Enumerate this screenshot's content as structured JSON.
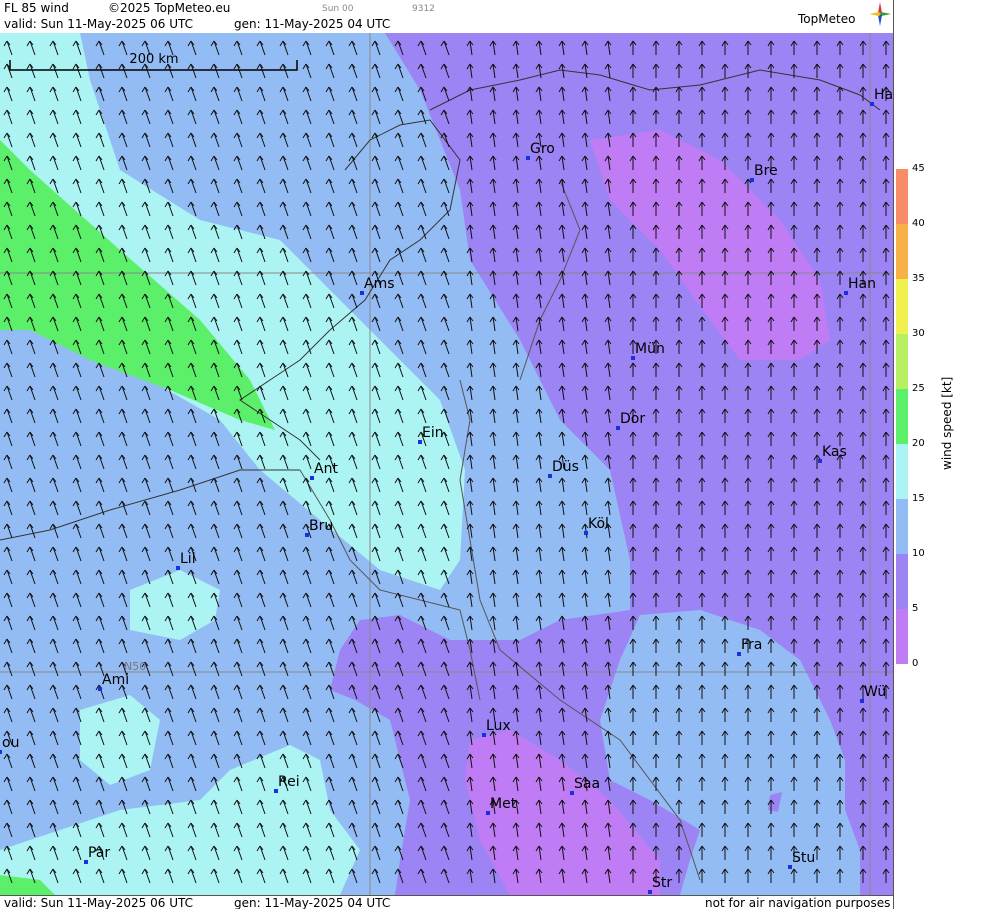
{
  "header": {
    "product": "FL 85 wind",
    "copyright": "©2025 TopMeteo.eu",
    "day_code": "Sun 00",
    "code": "9312",
    "valid": "valid:  Sun  11-May-2025  06 UTC",
    "gen": "gen: 11-May-2025 04 UTC",
    "logo": "TopMeteo"
  },
  "footer": {
    "valid": "valid:  Sun  11-May-2025  06 UTC",
    "gen": "gen: 11-May-2025 04 UTC",
    "disclaimer": "not for air navigation purposes"
  },
  "scale_bar": "200 km",
  "graticule_label": "N50",
  "colors": {
    "c0": "#c07cf4",
    "c5": "#9c84f4",
    "c10": "#94bcf4",
    "c15": "#acf4f4",
    "c20": "#5cf06a",
    "c25": "#b8f064",
    "c30": "#f0f050",
    "c35": "#f8b048",
    "c40": "#f88c68"
  },
  "legend": {
    "label": "wind speed [kt]",
    "ticks": [
      "45",
      "40",
      "35",
      "30",
      "25",
      "20",
      "15",
      "10",
      "5",
      "0"
    ]
  },
  "cities": [
    {
      "name": "Ha"
    },
    {
      "name": "Gro"
    },
    {
      "name": "Bre"
    },
    {
      "name": "Ams"
    },
    {
      "name": "Han"
    },
    {
      "name": "Mün"
    },
    {
      "name": "Dor"
    },
    {
      "name": "Ein"
    },
    {
      "name": "Kas"
    },
    {
      "name": "Ant"
    },
    {
      "name": "Düs"
    },
    {
      "name": "Bru"
    },
    {
      "name": "Köl"
    },
    {
      "name": "Lil"
    },
    {
      "name": "Fra"
    },
    {
      "name": "Ami"
    },
    {
      "name": "Wü"
    },
    {
      "name": "Lux"
    },
    {
      "name": "ou"
    },
    {
      "name": "Rei"
    },
    {
      "name": "Saa"
    },
    {
      "name": "Met"
    },
    {
      "name": "Stu"
    },
    {
      "name": "Par"
    },
    {
      "name": "Str"
    }
  ]
}
